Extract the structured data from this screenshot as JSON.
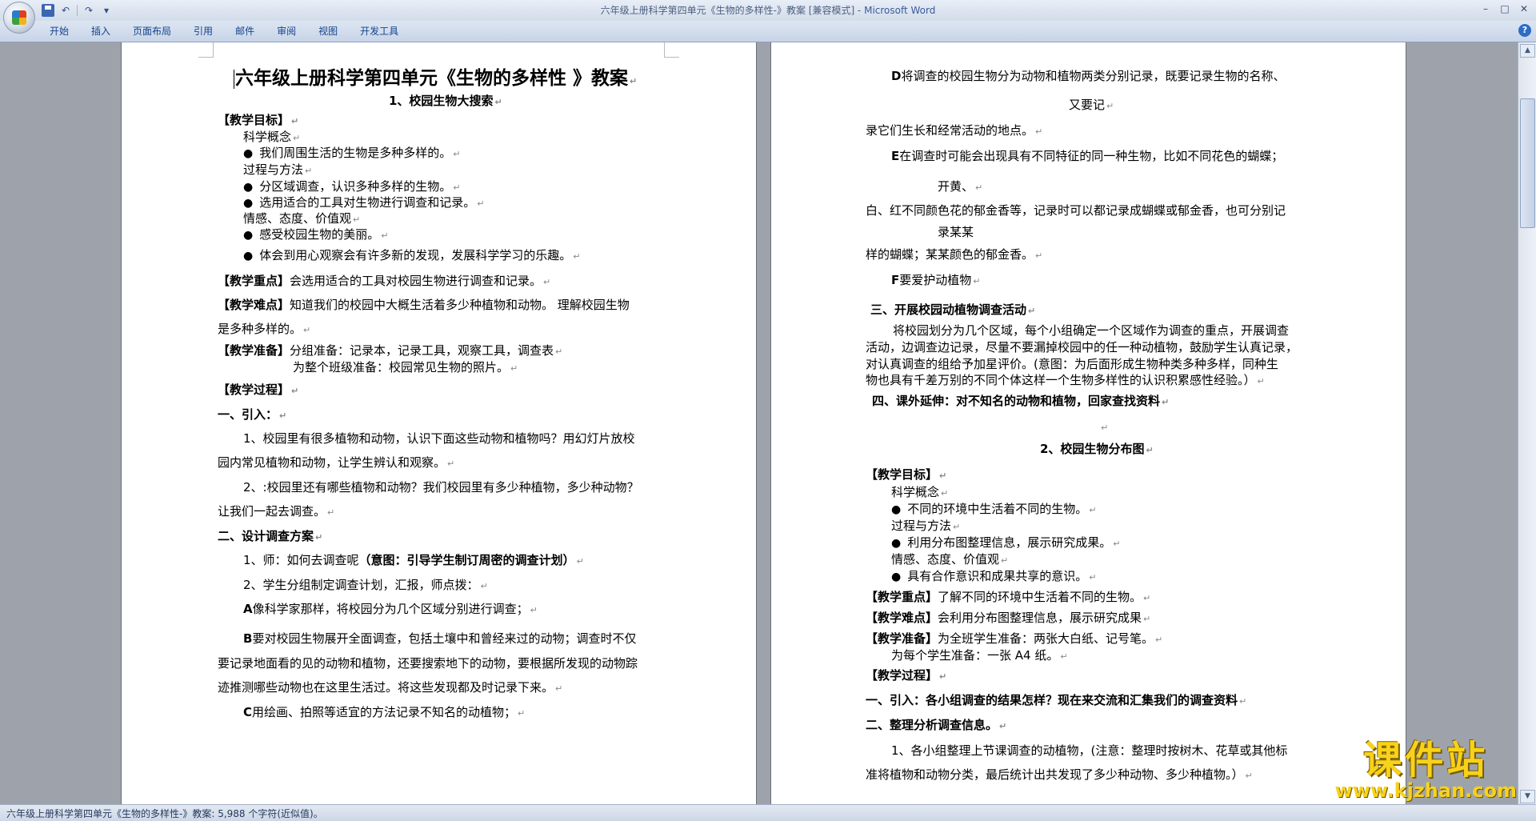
{
  "window": {
    "title": "六年级上册科学第四单元《生物的多样性-》教案 [兼容模式] -",
    "app_name": "Microsoft Word"
  },
  "qat": {
    "undo_glyph": "↶",
    "redo_glyph": "↷",
    "more_glyph": "▾"
  },
  "window_controls": {
    "minimize": "–",
    "maximize": "□",
    "close": "✕"
  },
  "ribbon": {
    "tabs": [
      "开始",
      "插入",
      "页面布局",
      "引用",
      "邮件",
      "审阅",
      "视图",
      "开发工具"
    ],
    "help_glyph": "?"
  },
  "page_left": {
    "title": "六年级上册科学第四单元《生物的多样性 》教案",
    "subtitle": "1、校园生物大搜索",
    "lines": [
      "【教学目标】",
      "科学概念",
      "我们周围生活的生物是多种多样的。",
      "过程与方法",
      "分区域调查，认识多种多样的生物。",
      "选用适合的工具对生物进行调查和记录。",
      "情感、态度、价值观",
      "感受校园生物的美丽。",
      "体会到用心观察会有许多新的发现，发展科学学习的乐趣。",
      "【教学重点】",
      "会选用适合的工具对校园生物进行调查和记录。",
      "【教学难点】",
      "知道我们的校园中大概生活着多少种植物和动物。 理解校园生物",
      "是多种多样的。",
      "【教学准备】",
      "分组准备：记录本，记录工具，观察工具，调查表",
      "为整个班级准备：校园常见生物的照片。",
      "【教学过程】",
      "一、引入：",
      "1、校园里有很多植物和动物，认识下面这些动物和植物吗？用幻灯片放校",
      "园内常见植物和动物，让学生辨认和观察。",
      "2、:校园里还有哪些植物和动物？我们校园里有多少种植物，多少种动物？",
      "让我们一起去调查。",
      "二、设计调查方案",
      "1、师：如何去调查呢",
      "（意图：引导学生制订周密的调查计划）",
      "2、学生分组制定调查计划，汇报，师点拨：",
      "A",
      "像科学家那样，将校园分为几个区域分别进行调查；",
      "B",
      "要对校园生物展开全面调查，包括土壤中和曾经来过的动物；调查时不仅",
      "要记录地面看的见的动物和植物，还要搜索地下的动物，要根据所发现的动物踪",
      "迹推测哪些动物也在这里生活过。将这些发现都及时记录下来。",
      "C",
      "用绘画、拍照等适宜的方法记录不知名的动植物；"
    ]
  },
  "page_right": {
    "lines": [
      "D",
      "将调查的校园生物分为动物和植物两类分别记录，既要记录生物的名称、",
      "又要记",
      "录它们生长和经常活动的地点。",
      "E",
      "在调查时可能会出现具有不同特征的同一种生物，比如不同花色的蝴蝶；",
      "开黄、",
      "白、红不同颜色花的郁金香等，记录时可以都记录成蝴蝶或郁金香，也可分别记",
      "录某某",
      "样的蝴蝶；某某颜色的郁金香。",
      "F",
      "要爱护动植物",
      "三、开展校园动植物调查活动",
      "将校园划分为几个区域，每个小组确定一个区域作为调查的重点，开展调查",
      "活动，边调查边记录，尽量不要漏掉校园中的任一种动植物，鼓励学生认真记录，",
      "对认真调查的组给予加星评价。(意图：为后面形成生物种类多种多样，同种生",
      "物也具有千差万别的不同个体这样一个生物多样性的认识积累感性经验。）",
      "四、课外延伸：对不知名的动物和植物，回家查找资料",
      "2、校园生物分布图",
      "【教学目标】",
      "科学概念",
      "不同的环境中生活着不同的生物。",
      "过程与方法",
      "利用分布图整理信息，展示研究成果。",
      "情感、态度、价值观",
      "具有合作意识和成果共享的意识。",
      "【教学重点】",
      "了解不同的环境中生活着不同的生物。",
      "【教学难点】",
      "会利用分布图整理信息，展示研究成果",
      "【教学准备】",
      "为全班学生准备：两张大白纸、记号笔。",
      "为每个学生准备：一张 A4 纸。",
      "【教学过程】",
      "一、引入：各小组调查的结果怎样？现在来交流和汇集我们的调查资料",
      "二、整理分析调查信息。",
      "1、各小组整理上节课调查的动植物，(注意：整理时按树木、花草或其他标",
      "准将植物和动物分类，最后统计出共发现了多少种动物、多少种植物。）"
    ]
  },
  "status_bar": {
    "text": "六年级上册科学第四单元《生物的多样性-》教案: 5,988 个字符(近似值)。"
  },
  "watermark": {
    "main": "课件站",
    "url": "www.kjzhan.com"
  },
  "scrollbar": {
    "up_glyph": "▲",
    "down_glyph": "▼"
  }
}
